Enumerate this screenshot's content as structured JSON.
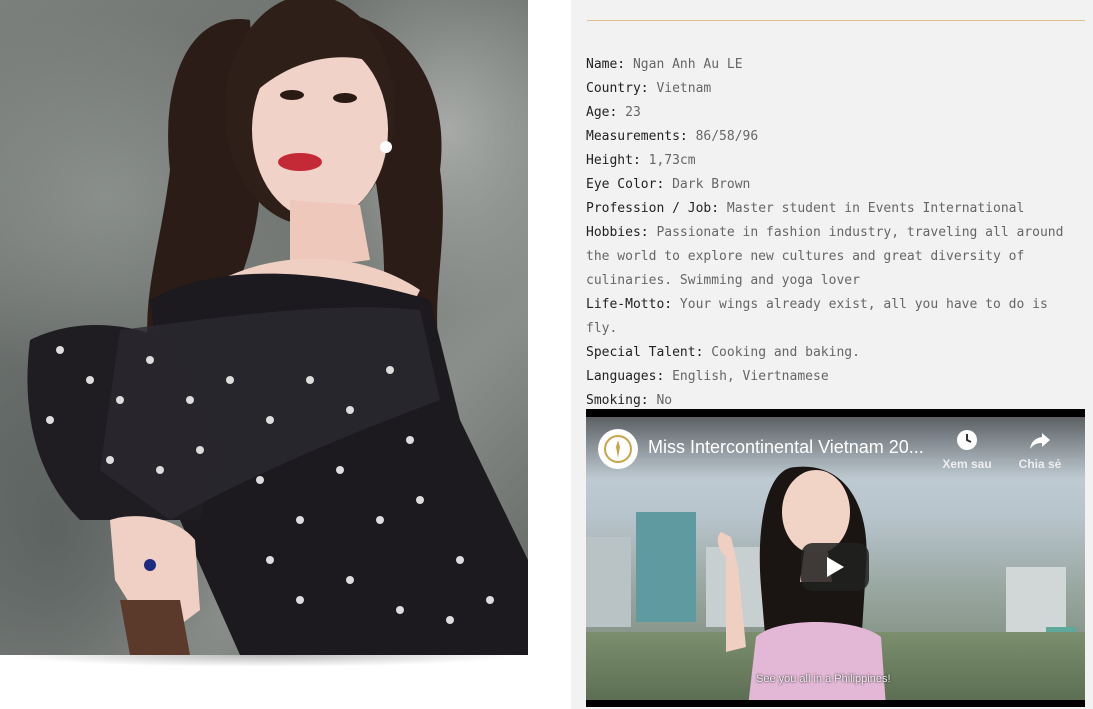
{
  "profile": {
    "photo_icon": "portrait-photo",
    "fields": [
      {
        "label": "Name:",
        "value": "Ngan Anh Au LE"
      },
      {
        "label": "Country:",
        "value": "Vietnam"
      },
      {
        "label": "Age:",
        "value": "23"
      },
      {
        "label": "Measurements:",
        "value": "86/58/96"
      },
      {
        "label": "Height:",
        "value": "1,73cm"
      },
      {
        "label": "Eye Color:",
        "value": "Dark Brown"
      },
      {
        "label": "Profession / Job:",
        "value": "Master student in Events International"
      },
      {
        "label": "Hobbies:",
        "value": "Passionate in fashion industry, traveling all around the world to explore new cultures and great diversity of culinaries. Swimming and yoga lover"
      },
      {
        "label": "Life-Motto:",
        "value": "Your wings already exist, all you have to do is fly."
      },
      {
        "label": "Special Talent:",
        "value": "Cooking and baking."
      },
      {
        "label": "Languages:",
        "value": "English, Viertnamese"
      },
      {
        "label": "Smoking:",
        "value": "No"
      }
    ]
  },
  "video": {
    "title": "Miss Intercontinental Vietnam 20...",
    "watch_later_label": "Xem sau",
    "share_label": "Chia sẻ",
    "caption": "See you all in a Philippines!",
    "colors": {
      "play_bg": "#212121",
      "accent": "#e2c08a"
    }
  }
}
